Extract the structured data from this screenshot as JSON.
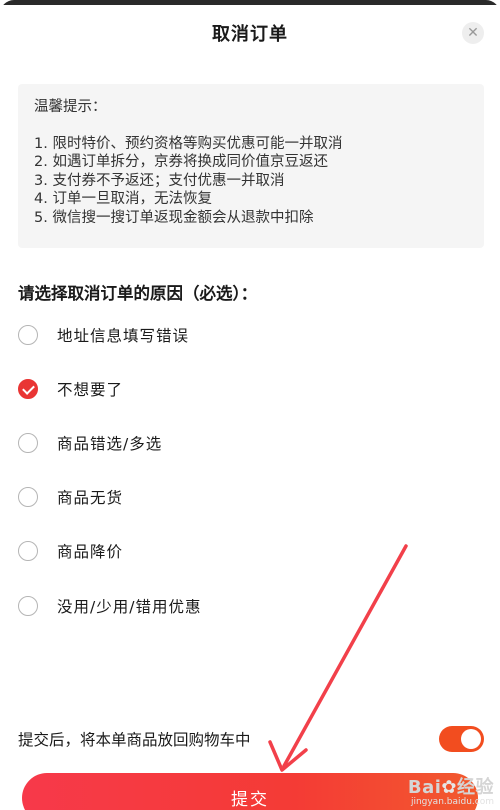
{
  "dialog": {
    "title": "取消订单",
    "close_symbol": "✕"
  },
  "tips": {
    "heading": "温馨提示：",
    "items": [
      "1. 限时特价、预约资格等购买优惠可能一并取消",
      "2. 如遇订单拆分，京券将换成同价值京豆返还",
      "3. 支付券不予返还；支付优惠一并取消",
      "4. 订单一旦取消，无法恢复",
      "5. 微信搜一搜订单返现金额会从退款中扣除"
    ]
  },
  "reasons": {
    "heading": "请选择取消订单的原因（必选）：",
    "selected_index": 1,
    "options": [
      "地址信息填写错误",
      "不想要了",
      "商品错选/多选",
      "商品无货",
      "商品降价",
      "没用/少用/错用优惠"
    ]
  },
  "return_to_cart": {
    "label": "提交后，将本单商品放回购物车中",
    "enabled": true
  },
  "submit": {
    "label": "提交"
  },
  "annotation": {
    "arrow_color": "#f2404a"
  },
  "watermark": {
    "logo_a": "Bai",
    "logo_paw": "✿",
    "logo_b": "经验",
    "url": "jingyan.baidu.com"
  },
  "colors": {
    "accent": "#e93534",
    "toggle_on": "#f24d1f",
    "tips_bg": "#f5f5f5"
  }
}
